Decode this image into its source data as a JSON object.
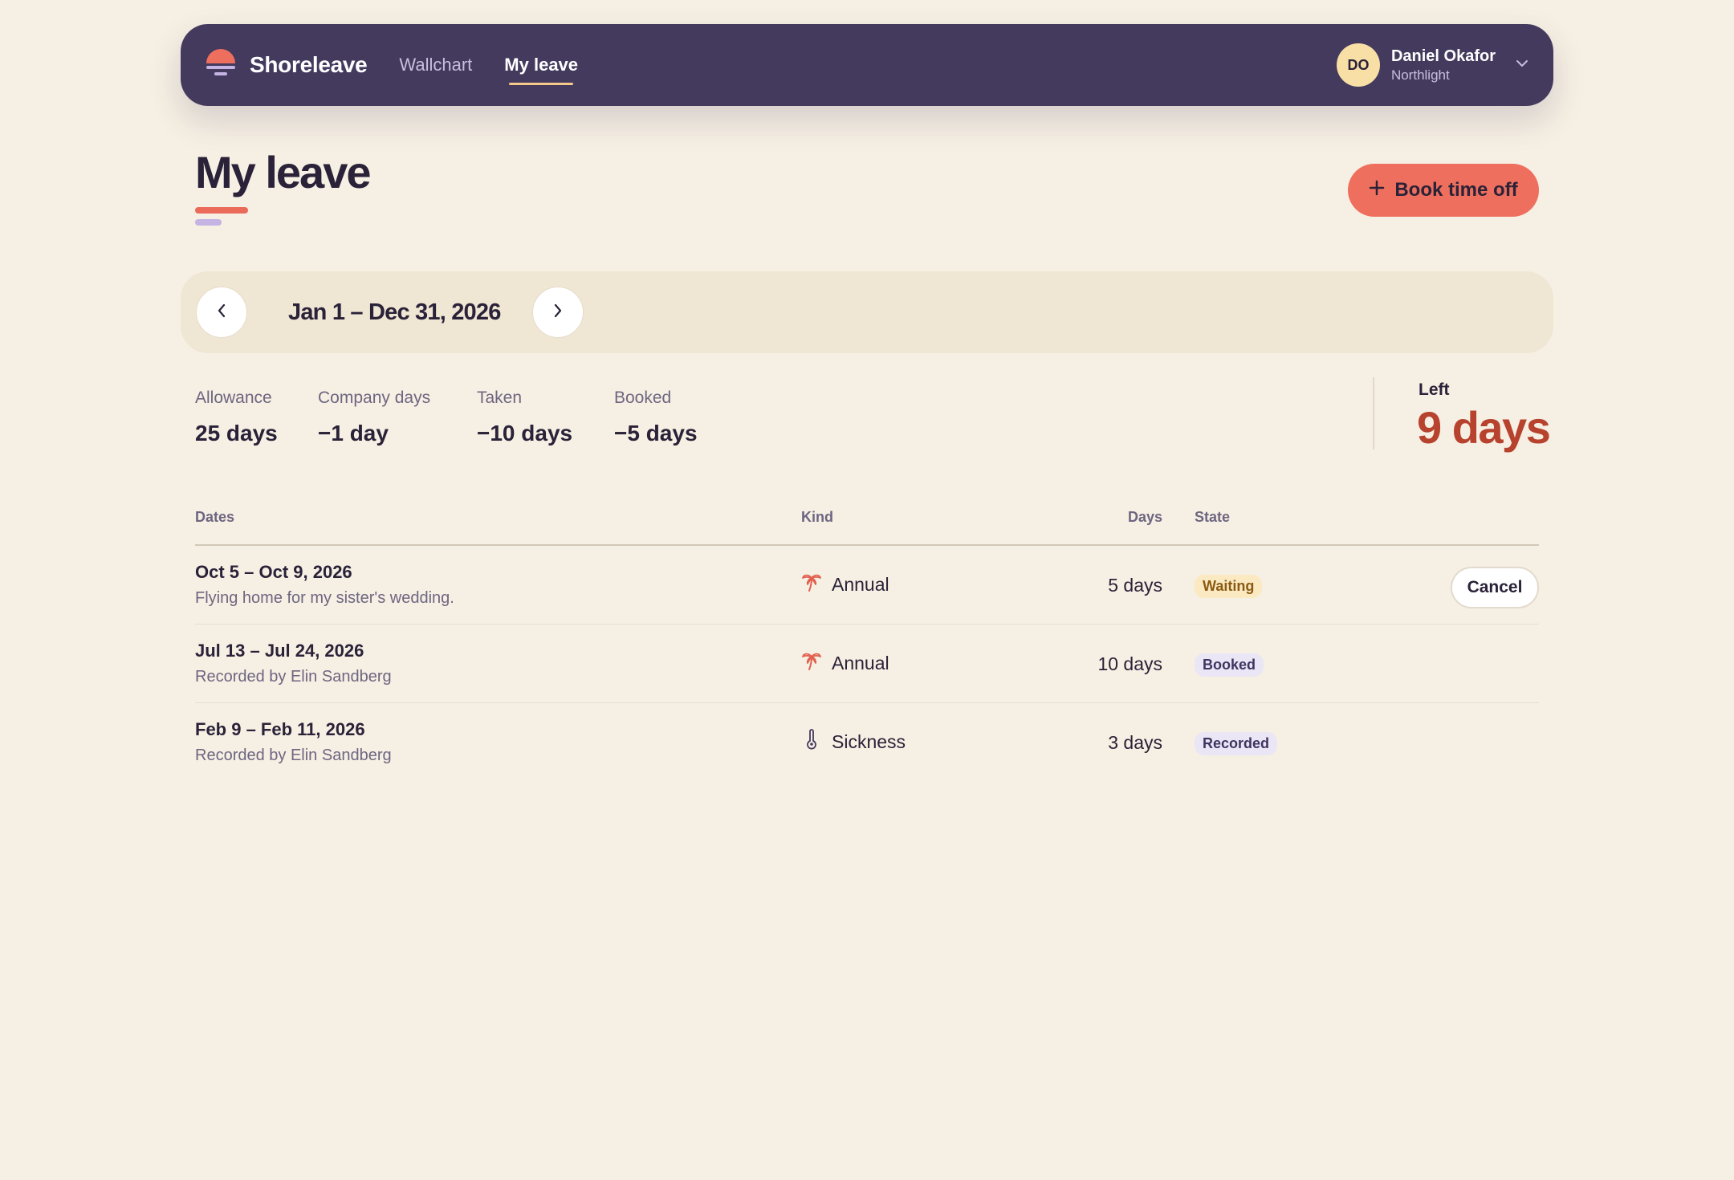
{
  "header": {
    "brand": "Shoreleave",
    "nav": [
      {
        "label": "Wallchart",
        "active": false
      },
      {
        "label": "My leave",
        "active": true
      }
    ],
    "user": {
      "initials": "DO",
      "name": "Daniel Okafor",
      "org": "Northlight"
    }
  },
  "page": {
    "title": "My leave",
    "book_label": "Book time off"
  },
  "period": {
    "label": "Jan 1 – Dec 31, 2026"
  },
  "stats": [
    {
      "label": "Allowance",
      "value": "25 days"
    },
    {
      "label": "Company days",
      "value": "−1 day"
    },
    {
      "label": "Taken",
      "value": "−10 days"
    },
    {
      "label": "Booked",
      "value": "−5 days"
    }
  ],
  "left": {
    "label": "Left",
    "value": "9 days"
  },
  "table": {
    "headers": {
      "dates": "Dates",
      "kind": "Kind",
      "days": "Days",
      "state": "State"
    },
    "rows": [
      {
        "dates": "Oct 5 – Oct 9, 2026",
        "note": "Flying home for my sister's wedding.",
        "kind": "Annual",
        "kind_icon": "palm-tree-icon",
        "days": "5 days",
        "state": "Waiting",
        "action": "Cancel"
      },
      {
        "dates": "Jul 13 – Jul 24, 2026",
        "note": "Recorded by Elin Sandberg",
        "kind": "Annual",
        "kind_icon": "palm-tree-icon",
        "days": "10 days",
        "state": "Booked"
      },
      {
        "dates": "Feb 9 – Feb 11, 2026",
        "note": "Recorded by Elin Sandberg",
        "kind": "Sickness",
        "kind_icon": "thermometer-icon",
        "days": "3 days",
        "state": "Recorded"
      }
    ]
  },
  "colors": {
    "header_bg": "#443a5e",
    "page_bg": "#f6efe3",
    "accent": "#ef6f5e",
    "left_value": "#b7432e",
    "waiting_bg": "#fbe9c2",
    "waiting_text": "#8a5a12",
    "booked_bg": "#ebe6f6",
    "recorded_bg": "#ebe6f6"
  }
}
